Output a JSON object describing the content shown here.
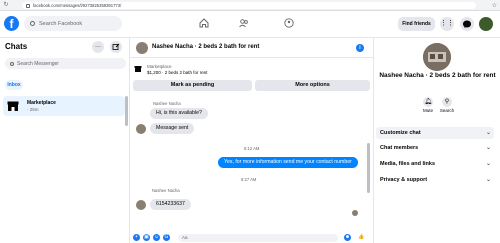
{
  "browser": {
    "url": "facebook.com/messages/t/9273825359391773/"
  },
  "topnav": {
    "logo": "f",
    "search_placeholder": "Search Facebook",
    "find_friends": "Find friends"
  },
  "sidebar": {
    "title": "Chats",
    "search_placeholder": "Search Messenger",
    "inbox_label": "Inbox",
    "conversations": [
      {
        "name": "Marketplace",
        "time": "· 25m"
      }
    ]
  },
  "chat": {
    "header_title": "Nashee Nacha · 2 beds 2 bath for rent",
    "marketplace_label": "Marketplace",
    "listing": "$1,200 · 2 beds 2 bath for rent",
    "mark_pending": "Mark as pending",
    "more_options": "More options",
    "messages": [
      {
        "sender": "Nashee Nacha",
        "text": "Hi, is this available?",
        "direction": "in"
      },
      {
        "text": "Message sent",
        "direction": "in"
      },
      {
        "stamp": "5:12 AM"
      },
      {
        "text": "Yes, for more information send me your contact number",
        "direction": "out"
      },
      {
        "stamp": "8:27 AM"
      },
      {
        "sender": "Nashee Nacha",
        "text": "6154233637",
        "direction": "in"
      }
    ],
    "composer_placeholder": "Aa"
  },
  "right_panel": {
    "name": "Nashee Nacha · 2 beds 2 bath for rent",
    "actions": [
      {
        "label": "Mute",
        "icon": "bell-icon"
      },
      {
        "label": "Search",
        "icon": "search-icon"
      }
    ],
    "sections": [
      {
        "label": "Customize chat"
      },
      {
        "label": "Chat members"
      },
      {
        "label": "Media, files and links"
      },
      {
        "label": "Privacy & support"
      }
    ]
  },
  "colors": {
    "brand": "#1877f2",
    "outgoing_bubble": "#0084ff",
    "selected_bg": "#e7f3ff"
  }
}
